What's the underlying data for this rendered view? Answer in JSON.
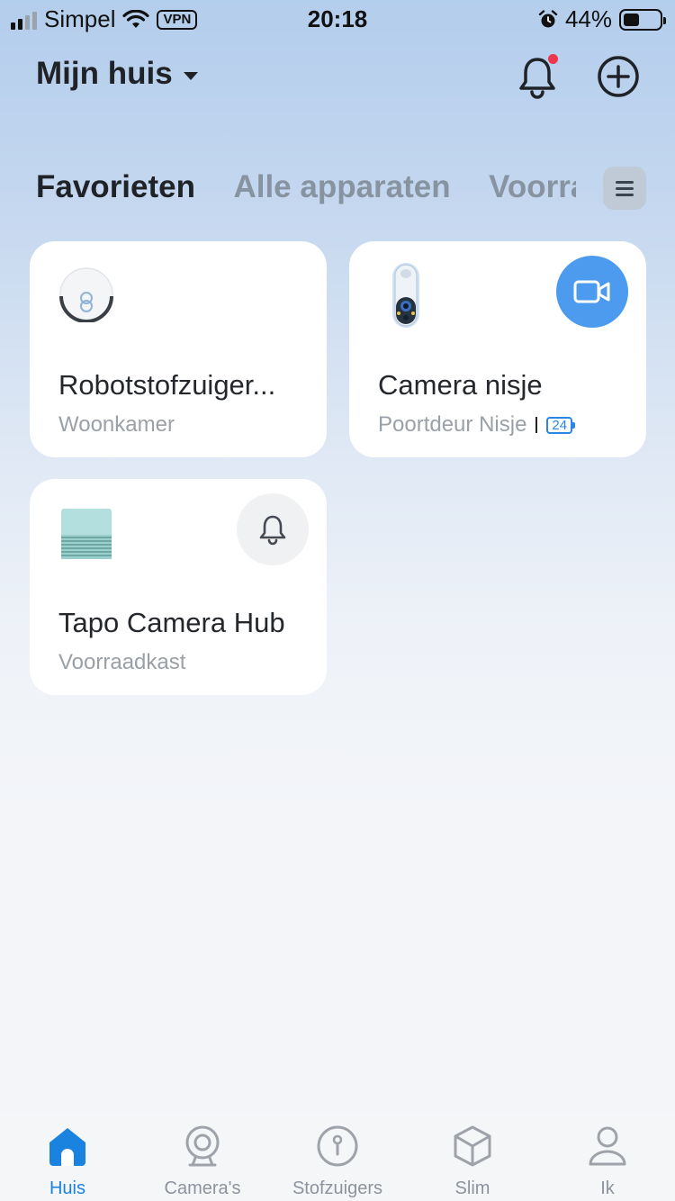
{
  "status_bar": {
    "carrier": "Simpel",
    "vpn": "VPN",
    "time": "20:18",
    "battery": "44%",
    "battery_level": 0.44
  },
  "header": {
    "home_name": "Mijn huis",
    "has_notification": true
  },
  "tabs": [
    {
      "label": "Favorieten",
      "active": true
    },
    {
      "label": "Alle apparaten",
      "active": false
    },
    {
      "label": "Voorraadkast",
      "active": false
    }
  ],
  "devices": [
    {
      "name": "Robotstofzuiger...",
      "room": "Woonkamer",
      "icon": "robot-vacuum-icon"
    },
    {
      "name": "Camera nisje",
      "room": "Poortdeur Nisje",
      "battery_badge": "24",
      "action_icon": "video-camera-icon"
    },
    {
      "name": "Tapo Camera Hub",
      "room": "Voorraadkast",
      "icon": "hub-icon",
      "action_icon": "bell-icon"
    }
  ],
  "bottom_nav": [
    {
      "label": "Huis",
      "icon": "home-icon",
      "active": true
    },
    {
      "label": "Camera's",
      "icon": "camera-icon",
      "active": false
    },
    {
      "label": "Stofzuigers",
      "icon": "vacuum-icon",
      "active": false
    },
    {
      "label": "Slim",
      "icon": "cube-icon",
      "active": false
    },
    {
      "label": "Ik",
      "icon": "person-icon",
      "active": false
    }
  ],
  "colors": {
    "accent": "#1a83e0",
    "camera_action": "#4c9bef",
    "notification_dot": "#f0364c"
  }
}
